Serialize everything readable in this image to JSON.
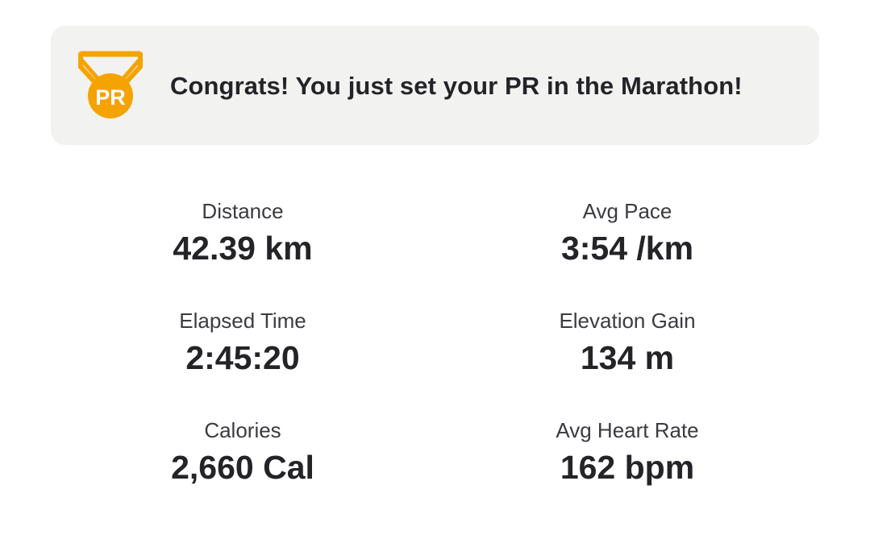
{
  "banner": {
    "message": "Congrats! You just set your PR in the Marathon!",
    "icon": "pr-medal-icon",
    "icon_text": "PR",
    "icon_color": "#f5a300"
  },
  "stats": [
    {
      "label": "Distance",
      "value": "42.39 km"
    },
    {
      "label": "Avg Pace",
      "value": "3:54 /km"
    },
    {
      "label": "Elapsed Time",
      "value": "2:45:20"
    },
    {
      "label": "Elevation Gain",
      "value": "134 m"
    },
    {
      "label": "Calories",
      "value": "2,660 Cal"
    },
    {
      "label": "Avg Heart Rate",
      "value": "162 bpm"
    }
  ]
}
